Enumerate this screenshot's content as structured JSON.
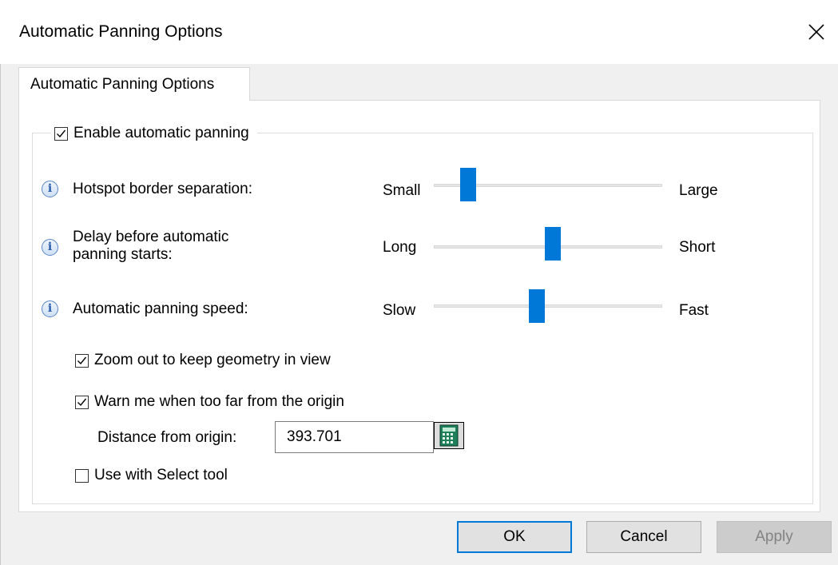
{
  "window": {
    "title": "Automatic Panning Options"
  },
  "tabs": [
    {
      "label": "Automatic Panning Options",
      "selected": true
    }
  ],
  "enable": {
    "label": "Enable automatic panning",
    "checked": true
  },
  "sliders": [
    {
      "label": "Hotspot border separation:",
      "min_label": "Small",
      "max_label": "Large",
      "value_fraction": 0.15
    },
    {
      "label_line1": "Delay before automatic",
      "label_line2": "panning starts:",
      "min_label": "Long",
      "max_label": "Short",
      "value_fraction": 0.52
    },
    {
      "label": "Automatic panning speed:",
      "min_label": "Slow",
      "max_label": "Fast",
      "value_fraction": 0.45
    }
  ],
  "options": {
    "zoom_out": {
      "label": "Zoom out to keep geometry in view",
      "checked": true
    },
    "warn": {
      "label": "Warn me when too far from the origin",
      "checked": true
    },
    "distance": {
      "label": "Distance from origin:",
      "value": "393.701"
    },
    "select_tool": {
      "label": "Use with Select tool",
      "checked": false
    }
  },
  "buttons": {
    "ok": "OK",
    "cancel": "Cancel",
    "apply": "Apply"
  },
  "icons": {
    "close": "close-icon",
    "info": "info-icon",
    "calculator": "calculator-icon",
    "check": "checkmark-icon"
  },
  "colors": {
    "accent": "#0078d7",
    "info_blue": "#2a5caa"
  }
}
